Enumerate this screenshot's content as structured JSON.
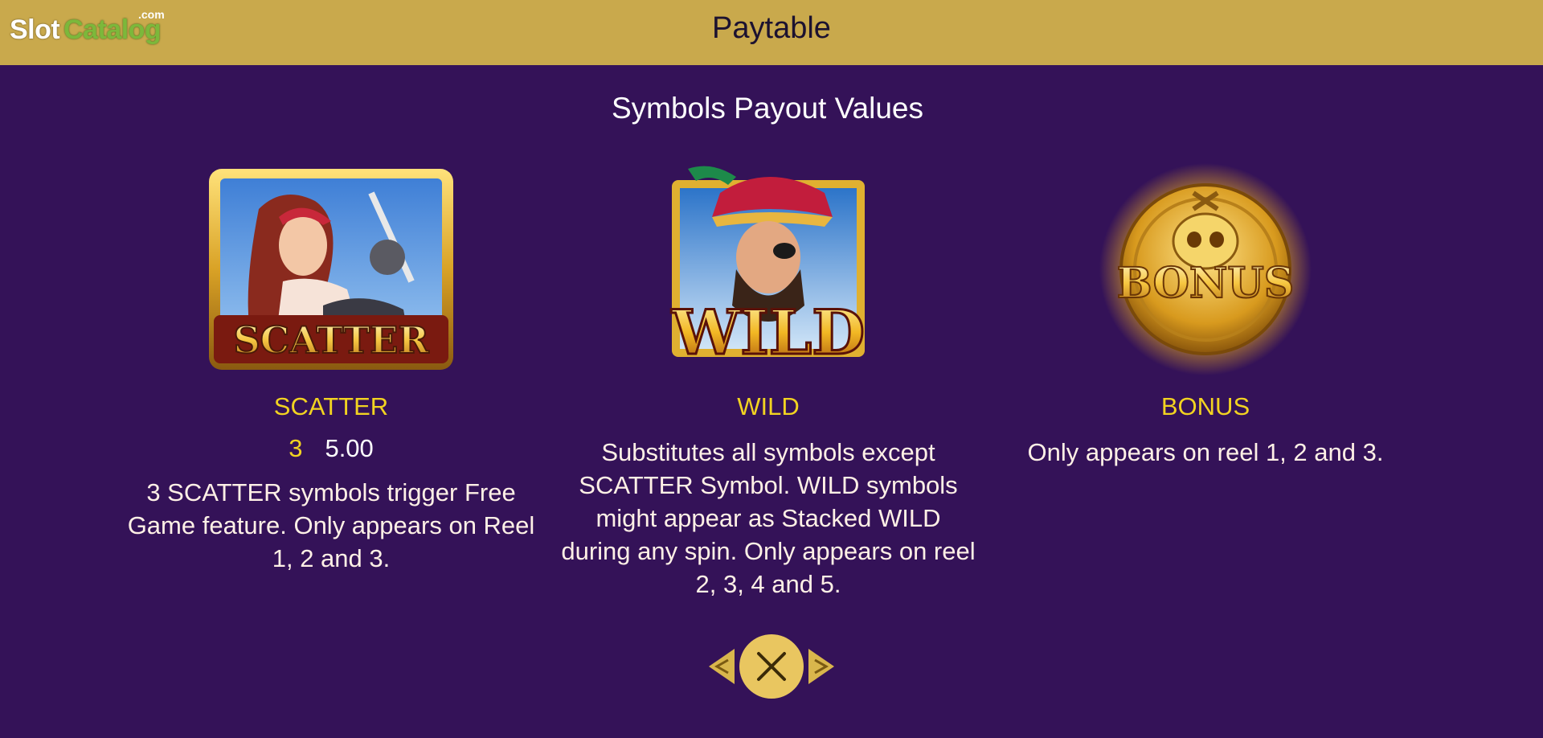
{
  "header": {
    "logo_slot": "Slot",
    "logo_catalog": "Catalog",
    "logo_com": ".com",
    "title": "Paytable"
  },
  "section": {
    "subtitle": "Symbols Payout Values"
  },
  "symbols": [
    {
      "name": "SCATTER",
      "art_label": "SCATTER",
      "pay_count": "3",
      "pay_value": "5.00",
      "description": "3 SCATTER symbols trigger Free Game feature. Only appears on Reel 1, 2 and 3."
    },
    {
      "name": "WILD",
      "art_label": "WILD",
      "description": "Substitutes all symbols except SCATTER Symbol. WILD symbols might appear as Stacked WILD during any spin. Only appears on reel 2, 3, 4 and 5."
    },
    {
      "name": "BONUS",
      "art_label": "BONUS",
      "description": "Only appears on reel 1, 2 and 3."
    }
  ],
  "icons": {
    "prev": "chevron-left-icon",
    "close": "close-icon",
    "next": "chevron-right-icon"
  },
  "colors": {
    "background": "#341258",
    "header": "#c9a94c",
    "symbol_name": "#f2d321",
    "button": "#e9c660"
  }
}
